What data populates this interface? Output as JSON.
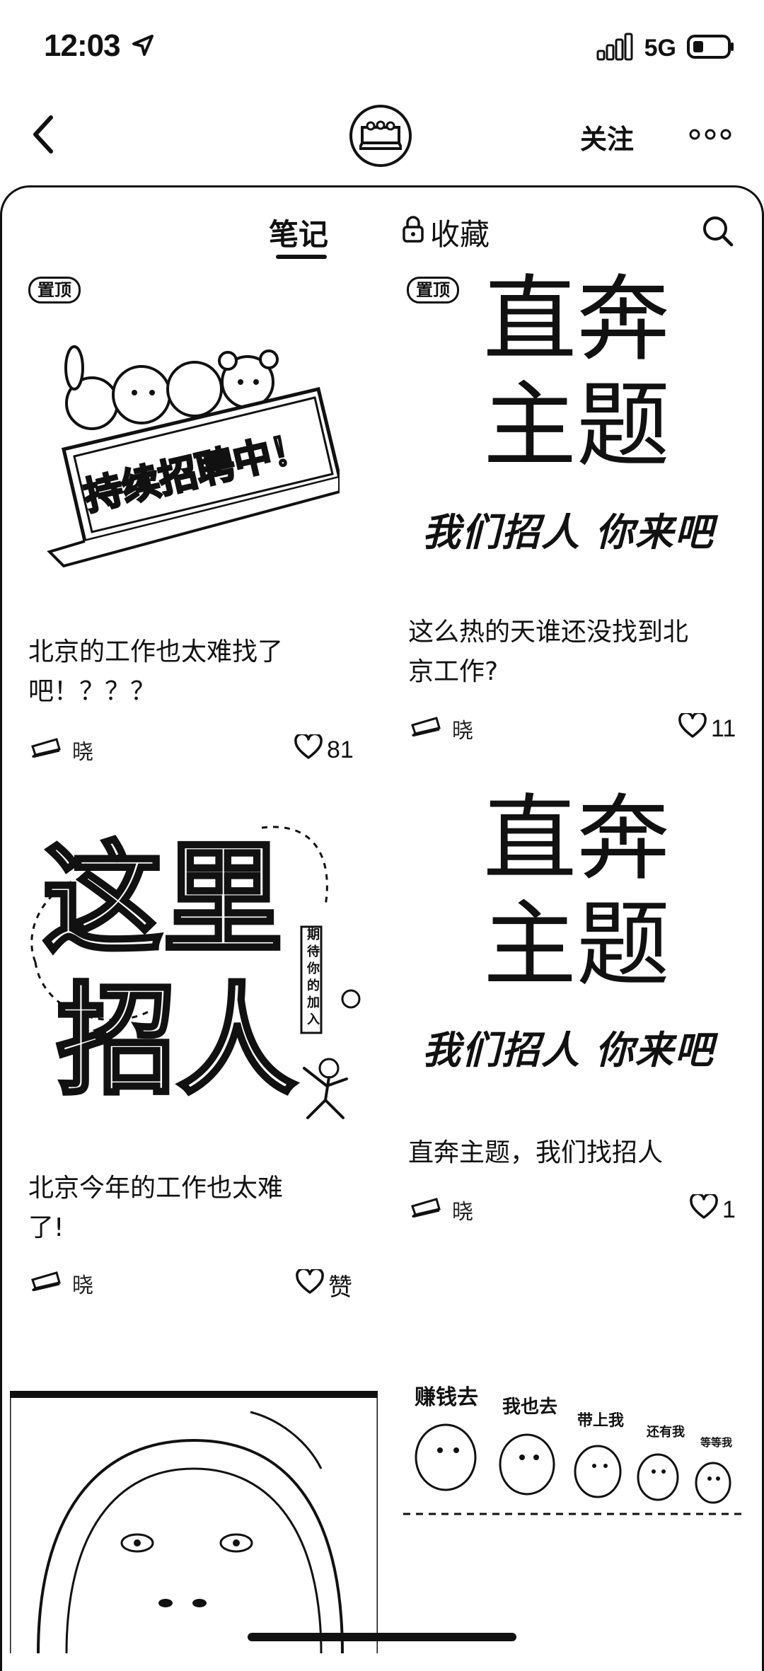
{
  "status_bar": {
    "time": "12:03",
    "network": "5G"
  },
  "top_bar": {
    "follow_label": "关注"
  },
  "tabs": {
    "notes": "笔记",
    "favorites": "收藏"
  },
  "cards": [
    {
      "pinned_label": "置顶",
      "image_text": "持续招聘中！",
      "title": "北京的工作也太难找了\n吧！？？？",
      "author": "晓",
      "likes": "81"
    },
    {
      "pinned_label": "置顶",
      "image_line1": "直奔",
      "image_line2": "主题",
      "image_tagline": "我们招人 你来吧",
      "title": "这么热的天谁还没找到北\n京工作?",
      "author": "晓",
      "likes": "11"
    },
    {
      "image_line1": "这里",
      "image_line2": "招人",
      "image_side_text": "期待你的加入",
      "title": "北京今年的工作也太难\n了!",
      "author": "晓",
      "likes": "赞"
    },
    {
      "image_line1": "直奔",
      "image_line2": "主题",
      "image_tagline": "我们招人 你来吧",
      "title": "直奔主题，我们找招人",
      "author": "晓",
      "likes": "1"
    },
    {},
    {
      "image_labels": [
        "赚钱去",
        "我也去",
        "带上我",
        "还有我",
        "等等我"
      ]
    }
  ]
}
